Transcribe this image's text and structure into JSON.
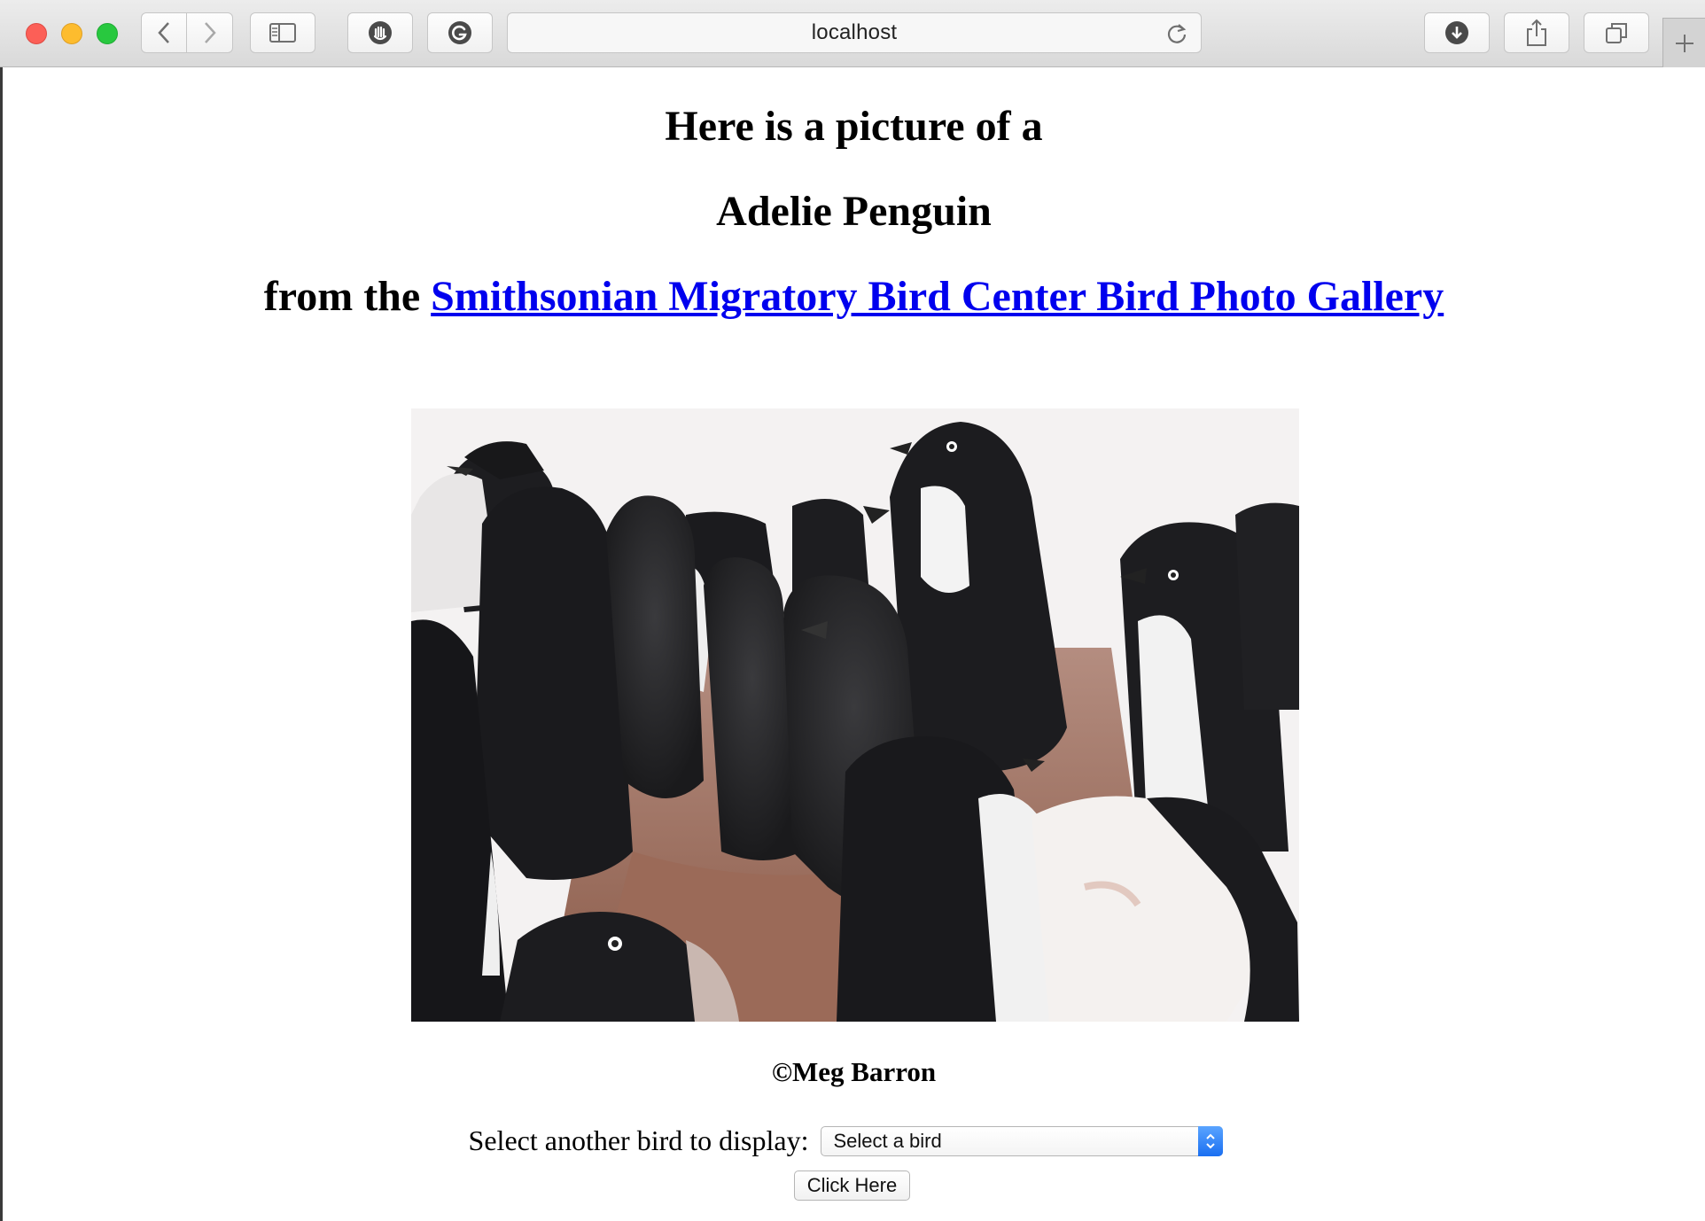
{
  "browser": {
    "address": "localhost",
    "icons": {
      "back": "chevron-left-icon",
      "forward": "chevron-right-icon",
      "sidebar": "sidebar-icon",
      "extension1": "hand-stop-icon",
      "extension2": "grammarly-icon",
      "reload": "reload-icon",
      "download": "download-icon",
      "share": "share-icon",
      "tabs": "tabs-icon",
      "new_tab": "plus-icon"
    }
  },
  "page": {
    "heading_line1": "Here is a picture of a",
    "bird_name": "Adelie Penguin",
    "heading_line3_prefix": "from the",
    "gallery_link_text": "Smithsonian Migratory Bird Center Bird Photo Gallery",
    "photo_alt": "Adelie Penguin",
    "credit": "©Meg Barron",
    "select_label": "Select another bird to display:",
    "select_value": "Select a bird",
    "submit_label": "Click Here"
  },
  "colors": {
    "link": "#0000ee",
    "select_accent": "#1a6ff1"
  }
}
